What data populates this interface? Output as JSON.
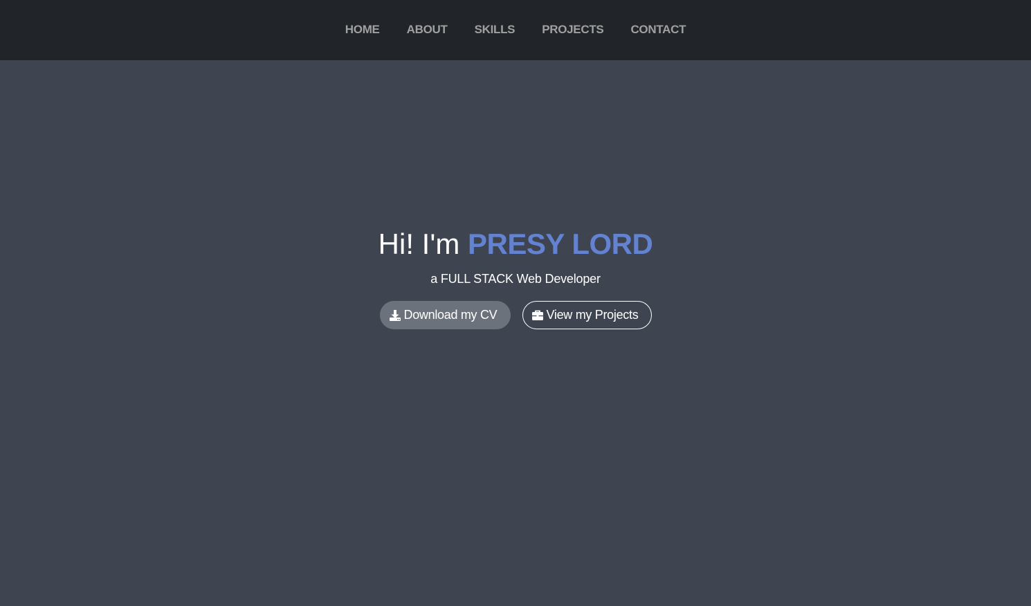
{
  "nav": {
    "items": [
      {
        "label": "HOME"
      },
      {
        "label": "ABOUT"
      },
      {
        "label": "SKILLS"
      },
      {
        "label": "PROJECTS"
      },
      {
        "label": "CONTACT"
      }
    ]
  },
  "hero": {
    "greeting": "Hi! I'm",
    "name": "PRESY LORD",
    "subtitle": "a FULL STACK Web Developer",
    "buttons": {
      "download_cv": {
        "label": "Download my CV",
        "icon": "download-icon"
      },
      "view_projects": {
        "label": "View my Projects",
        "icon": "briefcase-icon"
      }
    }
  },
  "colors": {
    "navbar_bg": "#212429",
    "page_bg": "#3f4550",
    "accent": "#6383d2",
    "nav_text": "#a0a0a0",
    "button_filled_bg": "#6c727b"
  }
}
